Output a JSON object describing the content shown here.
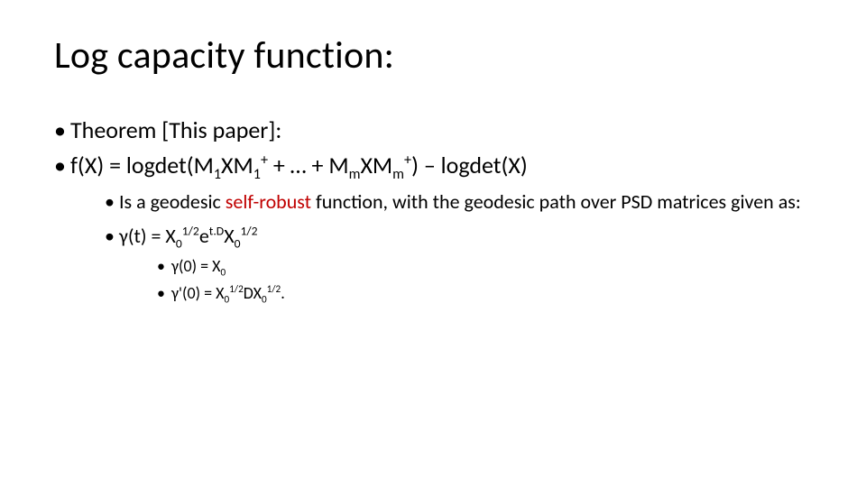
{
  "title": "Log capacity function:",
  "bullets": {
    "b1": "Theorem [This paper]:",
    "b2_pre": "f(X) = logdet(M",
    "b2_s1": "1",
    "b2_mid1": "XM",
    "b2_s2": "1",
    "b2_plus1": "+",
    "b2_mid2": " + … + M",
    "b2_sm1": "m",
    "b2_mid3": "XM",
    "b2_sm2": "m",
    "b2_plus2": "+",
    "b2_tail": ") – logdet(X)",
    "c1_pre": "Is a geodesic ",
    "c1_red": "self-robust",
    "c1_post": " function, with the geodesic path over PSD matrices given as:",
    "c2_pre": "γ(t) = X",
    "c2_s0a": "0",
    "c2_half1": "1/2",
    "c2_mid": "e",
    "c2_tD": "t.D",
    "c2_x": "X",
    "c2_s0b": "0",
    "c2_half2": "1/2",
    "d1_pre": "γ(0) = X",
    "d1_s0": "0",
    "d2_pre": "γ'(0) = X",
    "d2_s0a": "0",
    "d2_half1": "1/2",
    "d2_mid": "DX",
    "d2_s0b": "0",
    "d2_half2": "1/2",
    "d2_dot": "."
  }
}
